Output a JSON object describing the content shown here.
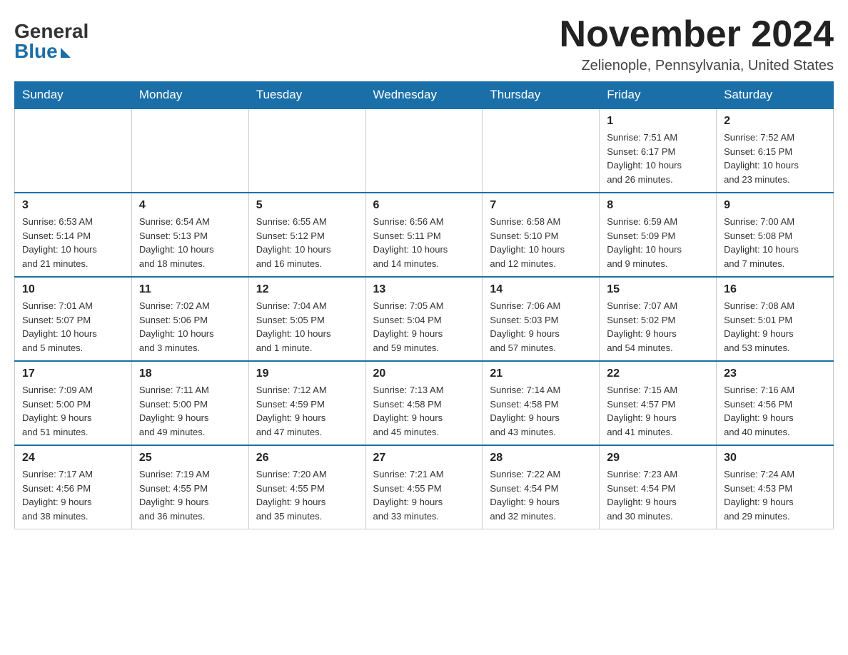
{
  "logo": {
    "general": "General",
    "blue": "Blue"
  },
  "title": "November 2024",
  "location": "Zelienople, Pennsylvania, United States",
  "weekdays": [
    "Sunday",
    "Monday",
    "Tuesday",
    "Wednesday",
    "Thursday",
    "Friday",
    "Saturday"
  ],
  "weeks": [
    [
      {
        "day": "",
        "info": ""
      },
      {
        "day": "",
        "info": ""
      },
      {
        "day": "",
        "info": ""
      },
      {
        "day": "",
        "info": ""
      },
      {
        "day": "",
        "info": ""
      },
      {
        "day": "1",
        "info": "Sunrise: 7:51 AM\nSunset: 6:17 PM\nDaylight: 10 hours\nand 26 minutes."
      },
      {
        "day": "2",
        "info": "Sunrise: 7:52 AM\nSunset: 6:15 PM\nDaylight: 10 hours\nand 23 minutes."
      }
    ],
    [
      {
        "day": "3",
        "info": "Sunrise: 6:53 AM\nSunset: 5:14 PM\nDaylight: 10 hours\nand 21 minutes."
      },
      {
        "day": "4",
        "info": "Sunrise: 6:54 AM\nSunset: 5:13 PM\nDaylight: 10 hours\nand 18 minutes."
      },
      {
        "day": "5",
        "info": "Sunrise: 6:55 AM\nSunset: 5:12 PM\nDaylight: 10 hours\nand 16 minutes."
      },
      {
        "day": "6",
        "info": "Sunrise: 6:56 AM\nSunset: 5:11 PM\nDaylight: 10 hours\nand 14 minutes."
      },
      {
        "day": "7",
        "info": "Sunrise: 6:58 AM\nSunset: 5:10 PM\nDaylight: 10 hours\nand 12 minutes."
      },
      {
        "day": "8",
        "info": "Sunrise: 6:59 AM\nSunset: 5:09 PM\nDaylight: 10 hours\nand 9 minutes."
      },
      {
        "day": "9",
        "info": "Sunrise: 7:00 AM\nSunset: 5:08 PM\nDaylight: 10 hours\nand 7 minutes."
      }
    ],
    [
      {
        "day": "10",
        "info": "Sunrise: 7:01 AM\nSunset: 5:07 PM\nDaylight: 10 hours\nand 5 minutes."
      },
      {
        "day": "11",
        "info": "Sunrise: 7:02 AM\nSunset: 5:06 PM\nDaylight: 10 hours\nand 3 minutes."
      },
      {
        "day": "12",
        "info": "Sunrise: 7:04 AM\nSunset: 5:05 PM\nDaylight: 10 hours\nand 1 minute."
      },
      {
        "day": "13",
        "info": "Sunrise: 7:05 AM\nSunset: 5:04 PM\nDaylight: 9 hours\nand 59 minutes."
      },
      {
        "day": "14",
        "info": "Sunrise: 7:06 AM\nSunset: 5:03 PM\nDaylight: 9 hours\nand 57 minutes."
      },
      {
        "day": "15",
        "info": "Sunrise: 7:07 AM\nSunset: 5:02 PM\nDaylight: 9 hours\nand 54 minutes."
      },
      {
        "day": "16",
        "info": "Sunrise: 7:08 AM\nSunset: 5:01 PM\nDaylight: 9 hours\nand 53 minutes."
      }
    ],
    [
      {
        "day": "17",
        "info": "Sunrise: 7:09 AM\nSunset: 5:00 PM\nDaylight: 9 hours\nand 51 minutes."
      },
      {
        "day": "18",
        "info": "Sunrise: 7:11 AM\nSunset: 5:00 PM\nDaylight: 9 hours\nand 49 minutes."
      },
      {
        "day": "19",
        "info": "Sunrise: 7:12 AM\nSunset: 4:59 PM\nDaylight: 9 hours\nand 47 minutes."
      },
      {
        "day": "20",
        "info": "Sunrise: 7:13 AM\nSunset: 4:58 PM\nDaylight: 9 hours\nand 45 minutes."
      },
      {
        "day": "21",
        "info": "Sunrise: 7:14 AM\nSunset: 4:58 PM\nDaylight: 9 hours\nand 43 minutes."
      },
      {
        "day": "22",
        "info": "Sunrise: 7:15 AM\nSunset: 4:57 PM\nDaylight: 9 hours\nand 41 minutes."
      },
      {
        "day": "23",
        "info": "Sunrise: 7:16 AM\nSunset: 4:56 PM\nDaylight: 9 hours\nand 40 minutes."
      }
    ],
    [
      {
        "day": "24",
        "info": "Sunrise: 7:17 AM\nSunset: 4:56 PM\nDaylight: 9 hours\nand 38 minutes."
      },
      {
        "day": "25",
        "info": "Sunrise: 7:19 AM\nSunset: 4:55 PM\nDaylight: 9 hours\nand 36 minutes."
      },
      {
        "day": "26",
        "info": "Sunrise: 7:20 AM\nSunset: 4:55 PM\nDaylight: 9 hours\nand 35 minutes."
      },
      {
        "day": "27",
        "info": "Sunrise: 7:21 AM\nSunset: 4:55 PM\nDaylight: 9 hours\nand 33 minutes."
      },
      {
        "day": "28",
        "info": "Sunrise: 7:22 AM\nSunset: 4:54 PM\nDaylight: 9 hours\nand 32 minutes."
      },
      {
        "day": "29",
        "info": "Sunrise: 7:23 AM\nSunset: 4:54 PM\nDaylight: 9 hours\nand 30 minutes."
      },
      {
        "day": "30",
        "info": "Sunrise: 7:24 AM\nSunset: 4:53 PM\nDaylight: 9 hours\nand 29 minutes."
      }
    ]
  ]
}
